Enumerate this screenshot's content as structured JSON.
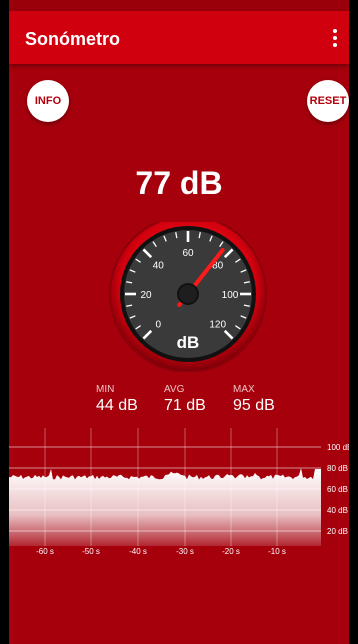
{
  "app": {
    "title": "Sonómetro",
    "menu_icon": "more-vert-icon"
  },
  "buttons": {
    "info": "INFO",
    "reset": "RESET"
  },
  "reading": {
    "value": "77",
    "unit": "dB",
    "display": "77 dB"
  },
  "gauge": {
    "scale": [
      "0",
      "20",
      "40",
      "60",
      "80",
      "100",
      "120"
    ],
    "unit": "dB",
    "needle_value": 77,
    "max": 120
  },
  "stats": {
    "min": {
      "label": "MIN",
      "value": "44 dB"
    },
    "avg": {
      "label": "AVG",
      "value": "71 dB"
    },
    "max": {
      "label": "MAX",
      "value": "95 dB"
    }
  },
  "history": {
    "y_labels": [
      "100 dB",
      "80 dB",
      "60 dB",
      "40 dB",
      "20 dB"
    ],
    "x_labels": [
      "-60 s",
      "-50 s",
      "-40 s",
      "-30 s",
      "-20 s",
      "-10 s"
    ]
  },
  "colors": {
    "background": "#a5000c",
    "appbar": "#d0000f",
    "accent": "#ff1a1a"
  }
}
